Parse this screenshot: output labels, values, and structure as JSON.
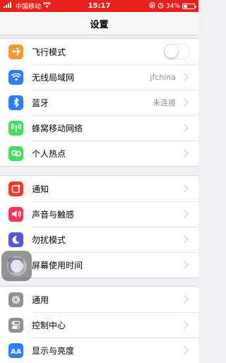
{
  "status": {
    "carrier": "中国移动",
    "time": "15:17",
    "battery": "34%",
    "battery_level": 0.34
  },
  "nav": {
    "title": "设置"
  },
  "group1": [
    {
      "label": "飞行模式",
      "type": "toggle",
      "on": false
    },
    {
      "label": "无线局域网",
      "value": "jfchina"
    },
    {
      "label": "蓝牙",
      "value": "未连接"
    },
    {
      "label": "蜂窝移动网络"
    },
    {
      "label": "个人热点"
    }
  ],
  "group2": [
    {
      "label": "通知"
    },
    {
      "label": "声音与触感"
    },
    {
      "label": "勿扰模式"
    },
    {
      "label": "屏幕使用时间"
    }
  ],
  "group3": [
    {
      "label": "通用"
    },
    {
      "label": "控制中心"
    },
    {
      "label": "显示与亮度"
    }
  ],
  "colors": {
    "statusbar": "#e8231f",
    "airplane": "#f09a37",
    "wifi": "#2f7cf6",
    "bluetooth": "#2f7cf6",
    "cellular": "#4cd964",
    "hotspot": "#4cd964",
    "notifications": "#f03c2f",
    "sounds": "#f0395a",
    "dnd": "#5856d6",
    "screentime": "#5856d6",
    "general": "#8e8e93",
    "control": "#8e8e93",
    "display": "#2f7cf6"
  }
}
